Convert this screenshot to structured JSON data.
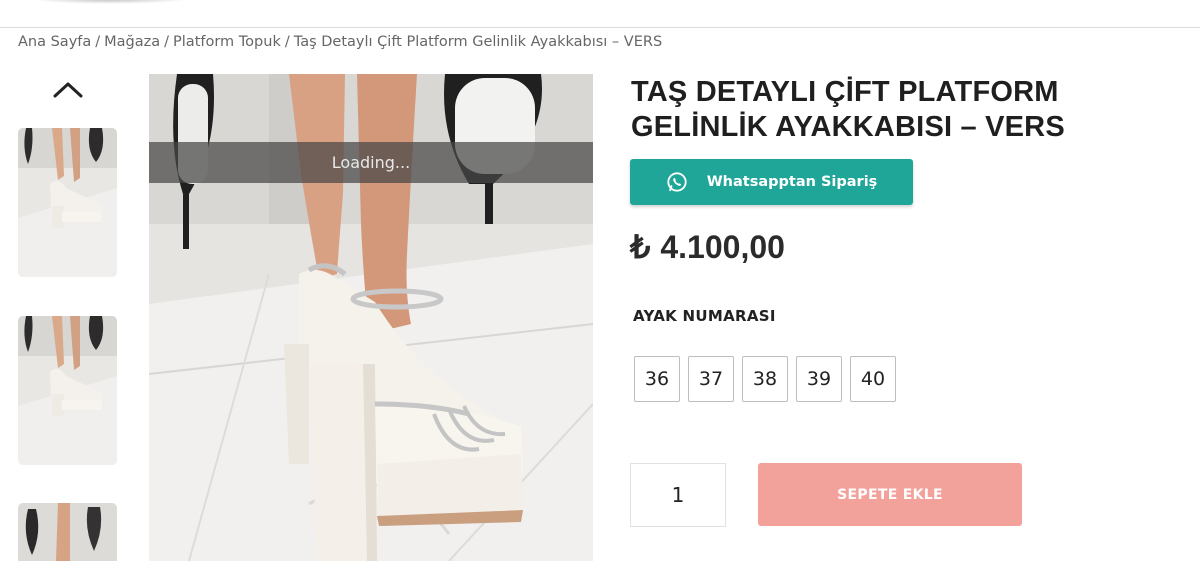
{
  "breadcrumb": {
    "items": [
      "Ana Sayfa",
      "Mağaza",
      "Platform Topuk",
      "Taş Detaylı Çift Platform Gelinlik Ayakkabısı – VERS"
    ],
    "separator": "/"
  },
  "gallery": {
    "up_icon": "chevron-up-icon",
    "thumbnails": [
      "thumbnail-1",
      "thumbnail-2",
      "thumbnail-3"
    ],
    "loading_text": "Loading..."
  },
  "product": {
    "title": "TAŞ DETAYLI ÇİFT PLATFORM GELİNLİK AYAKKABISI – VERS",
    "whatsapp_label": "Whatsapptan Sipariş",
    "whatsapp_icon": "whatsapp-icon",
    "currency": "₺",
    "price": "4.100,00",
    "size_label": "AYAK NUMARASI",
    "sizes": [
      "36",
      "37",
      "38",
      "39",
      "40"
    ],
    "quantity": "1",
    "add_to_cart_label": "SEPETE EKLE"
  },
  "colors": {
    "whatsapp_button": "#20a599",
    "cart_button": "#f2a19b"
  }
}
